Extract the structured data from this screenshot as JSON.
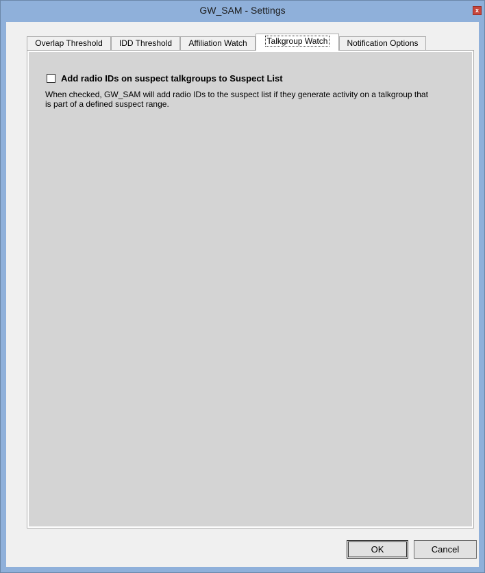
{
  "window": {
    "title": "GW_SAM - Settings",
    "close_glyph": "x"
  },
  "tabs": [
    {
      "label": "Overlap Threshold",
      "active": false
    },
    {
      "label": "IDD Threshold",
      "active": false
    },
    {
      "label": "Affiliation Watch",
      "active": false
    },
    {
      "label": "Talkgroup Watch",
      "active": true
    },
    {
      "label": "Notification Options",
      "active": false
    }
  ],
  "talkgroup_watch": {
    "checkbox_label": "Add radio IDs on suspect talkgroups to Suspect List",
    "checkbox_checked": false,
    "description": "When checked, GW_SAM will add radio IDs to the suspect list if they generate activity on a talkgroup that is part of a defined suspect range."
  },
  "buttons": {
    "ok_label": "OK",
    "cancel_label": "Cancel"
  },
  "colors": {
    "titlebar": "#8fb0da",
    "close_button": "#c7463c",
    "panel_background": "#d4d4d4",
    "dialog_background": "#f0f0f0"
  }
}
